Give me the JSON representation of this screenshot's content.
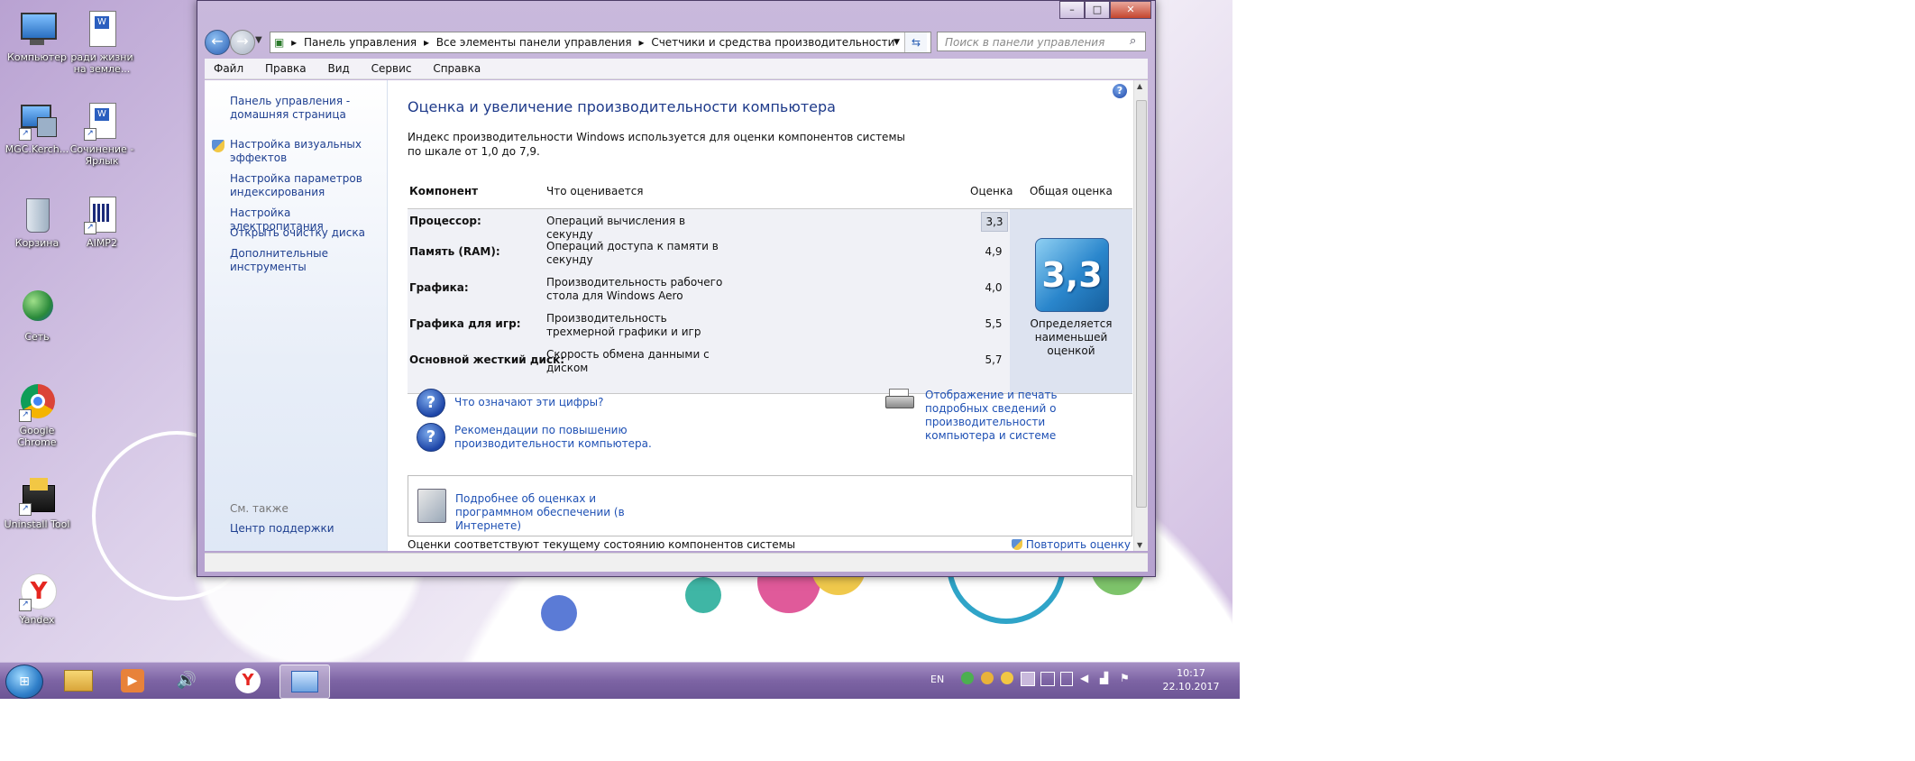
{
  "desktop": {
    "icons": [
      {
        "label": "Компьютер",
        "icon": "computer-icon"
      },
      {
        "label": "ради жизни на земле...",
        "icon": "word-document-icon"
      },
      {
        "label": "MGC.Kerch...",
        "icon": "network-computer-icon"
      },
      {
        "label": "Сочинение - Ярлык",
        "icon": "word-document-icon"
      },
      {
        "label": "Корзина",
        "icon": "recycle-bin-icon"
      },
      {
        "label": "AIMP2",
        "icon": "aimp-icon"
      },
      {
        "label": "Сеть",
        "icon": "network-icon"
      },
      {
        "label": "Google Chrome",
        "icon": "chrome-icon"
      },
      {
        "label": "Uninstall Tool",
        "icon": "uninstall-tool-icon"
      },
      {
        "label": "Yandex",
        "icon": "yandex-icon"
      }
    ]
  },
  "window": {
    "address": {
      "parts": [
        "Панель управления",
        "Все элементы панели управления",
        "Счетчики и средства производительности"
      ]
    },
    "search_placeholder": "Поиск в панели управления",
    "menu": [
      "Файл",
      "Правка",
      "Вид",
      "Сервис",
      "Справка"
    ],
    "sidebar": {
      "links": [
        "Панель управления - домашняя страница",
        "Настройка визуальных эффектов",
        "Настройка параметров индексирования",
        "Настройка электропитания",
        "Открыть очистку диска",
        "Дополнительные инструменты"
      ],
      "see_also_title": "См. также",
      "see_also_links": [
        "Центр поддержки"
      ]
    },
    "main": {
      "title": "Оценка и увеличение производительности компьютера",
      "description": "Индекс производительности Windows используется для оценки компонентов системы по шкале от 1,0 до 7,9.",
      "table": {
        "headers": {
          "component": "Компонент",
          "what": "Что оценивается",
          "score": "Оценка",
          "overall": "Общая оценка"
        },
        "rows": [
          {
            "component": "Процессор:",
            "what": "Операций вычисления в секунду",
            "score": "3,3"
          },
          {
            "component": "Память (RAM):",
            "what": "Операций доступа к памяти в секунду",
            "score": "4,9"
          },
          {
            "component": "Графика:",
            "what": "Производительность рабочего стола для Windows Aero",
            "score": "4,0"
          },
          {
            "component": "Графика для игр:",
            "what": "Производительность трехмерной графики и игр",
            "score": "5,5"
          },
          {
            "component": "Основной жесткий диск:",
            "what": "Скорость обмена данными с диском",
            "score": "5,7"
          }
        ],
        "overall_score": "3,3",
        "overall_note": "Определяется наименьшей оценкой"
      },
      "links": {
        "what_numbers": "Что означают эти цифры?",
        "tips": "Рекомендации по повышению производительности компьютера.",
        "print_details": "Отображение и печать подробных сведений о производительности компьютера и системе",
        "more_info": "Подробнее об оценках и программном обеспечении (в Интернете)",
        "rerun": "Повторить оценку"
      },
      "footer_text": "Оценки соответствуют текущему состоянию компонентов системы"
    }
  },
  "taskbar": {
    "language": "EN",
    "time": "10:17",
    "date": "22.10.2017"
  }
}
